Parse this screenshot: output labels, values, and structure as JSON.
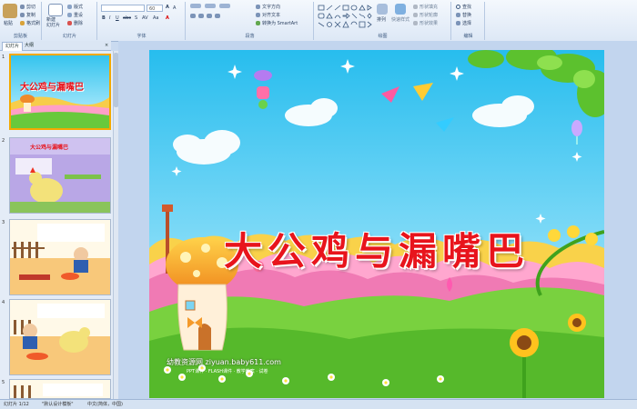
{
  "ribbon": {
    "clipboard": {
      "paste": "粘贴",
      "cut": "剪切",
      "copy": "复制",
      "format_painter": "格式刷",
      "caption": "剪贴板"
    },
    "slides": {
      "new_slide": "新建\n幻灯片",
      "layout": "版式",
      "reset": "重设",
      "delete": "删除",
      "caption": "幻灯片"
    },
    "font": {
      "font_name": "",
      "font_size": "60",
      "caption": "字体"
    },
    "paragraph": {
      "text_direction": "文字方向",
      "align_text": "对齐文本",
      "convert_smartart": "转换为 SmartArt",
      "caption": "段落"
    },
    "drawing": {
      "arrange": "排列",
      "quick_styles": "快速样式",
      "shape_fill": "形状填充",
      "shape_outline": "形状轮廓",
      "shape_effects": "形状效果",
      "caption": "绘图"
    },
    "editing": {
      "find": "查找",
      "replace": "替换",
      "select": "选择",
      "caption": "编辑"
    }
  },
  "panel_tabs": {
    "slides": "幻灯片",
    "outline": "大纲"
  },
  "thumbnails": [
    {
      "num": "1",
      "title": "大公鸡与漏嘴巴"
    },
    {
      "num": "2",
      "title": "大公鸡与漏嘴巴"
    },
    {
      "num": "3",
      "title": ""
    },
    {
      "num": "4",
      "title": ""
    },
    {
      "num": "5",
      "title": ""
    }
  ],
  "slide": {
    "title": "大公鸡与漏嘴巴",
    "watermark": "幼教资源网 ziyuan.baby611.com",
    "watermark_sub": "PPT课件 · FLASH课件 · 教学教案 · 试卷"
  },
  "status_bar": {
    "slide_pos": "幻灯片 1/12",
    "theme": "\"默认设计模板\"",
    "language": "中文(简体，中国)"
  },
  "colors": {
    "title_red": "#e8141c",
    "sky_top": "#3cc7f0",
    "sky_bottom": "#bff0ff",
    "grass": "#6cc93a",
    "ribbon_bg": "#dde8f6"
  }
}
